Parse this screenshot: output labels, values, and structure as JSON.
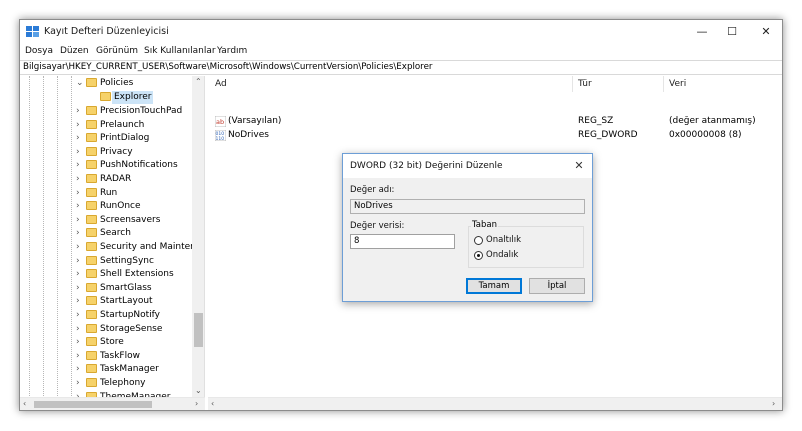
{
  "window": {
    "title": "Kayıt Defteri Düzenleyicisi",
    "controls": {
      "minimize": "—",
      "maximize": "☐",
      "close": "✕"
    }
  },
  "menu": [
    "Dosya",
    "Düzen",
    "Görünüm",
    "Sık Kullanılanlar",
    "Yardım"
  ],
  "address": "Bilgisayar\\HKEY_CURRENT_USER\\Software\\Microsoft\\Windows\\CurrentVersion\\Policies\\Explorer",
  "tree": {
    "parent": "Policies",
    "selected_child": "Explorer",
    "items": [
      "PrecisionTouchPad",
      "Prelaunch",
      "PrintDialog",
      "Privacy",
      "PushNotifications",
      "RADAR",
      "Run",
      "RunOnce",
      "Screensavers",
      "Search",
      "Security and Maintenai",
      "SettingSync",
      "Shell Extensions",
      "SmartGlass",
      "StartLayout",
      "StartupNotify",
      "StorageSense",
      "Store",
      "TaskFlow",
      "TaskManager",
      "Telephony",
      "ThemeManager"
    ]
  },
  "list": {
    "columns": {
      "name": "Ad",
      "type": "Tür",
      "data": "Veri"
    },
    "rows": [
      {
        "icon": "string-value-icon",
        "name": "(Varsayılan)",
        "type": "REG_SZ",
        "data": "(değer atanmamış)"
      },
      {
        "icon": "dword-value-icon",
        "name": "NoDrives",
        "type": "REG_DWORD",
        "data": "0x00000008 (8)"
      }
    ]
  },
  "dialog": {
    "title": "DWORD (32 bit) Değerini Düzenle",
    "value_name_label": "Değer adı:",
    "value_name": "NoDrives",
    "value_data_label": "Değer verisi:",
    "value_data": "8",
    "base_label": "Taban",
    "base_options": [
      {
        "label": "Onaltılık",
        "selected": false
      },
      {
        "label": "Ondalık",
        "selected": true
      }
    ],
    "ok_label": "Tamam",
    "cancel_label": "İptal",
    "close": "✕"
  },
  "colors": {
    "accent": "#0078d7",
    "selection": "#cce4f7",
    "folder": "#f6d26a"
  }
}
